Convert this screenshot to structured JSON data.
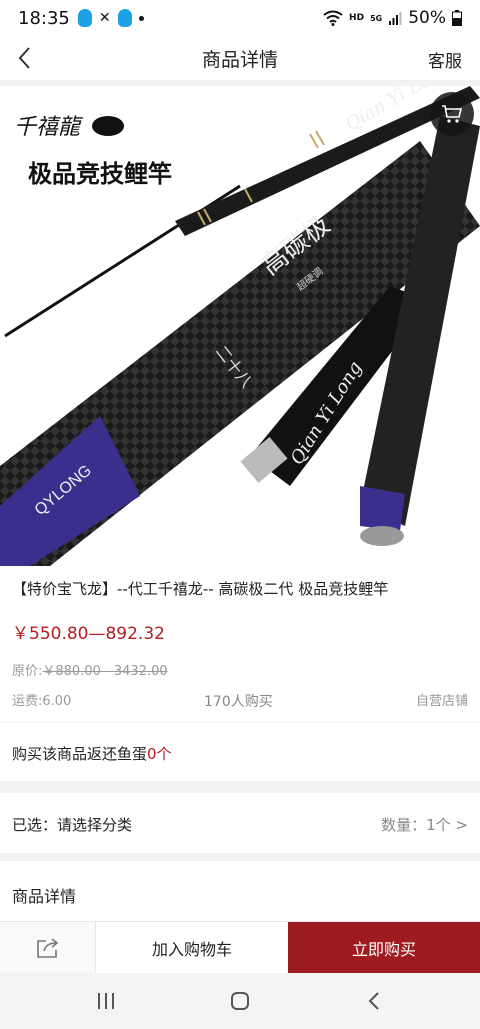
{
  "status_bar": {
    "time": "18:35",
    "network": "HD",
    "network_sub": "5G",
    "battery": "50%"
  },
  "nav": {
    "title": "商品详情",
    "service_label": "客服"
  },
  "product_image": {
    "logo_text": "千禧龍",
    "headline": "极品竞技鲤竿",
    "rod_text_1": "Qian Yi Long",
    "rod_text_2": "Qian Yi Long",
    "rod_text_3": "Qian Yi Long",
    "chinese_text": "高碳极",
    "chinese_small": "超硬调",
    "number_text": "二十八",
    "band_text": "QYLONG"
  },
  "product": {
    "name": "【特价宝飞龙】--代工千禧龙--  高碳极二代  极品竞技鲤竿",
    "price": "￥550.80—892.32",
    "original_price_label": "原价:",
    "original_price": "￥880.00—3432.00",
    "shipping": "运费:6.00",
    "buyers": "170人购买",
    "store_type": "自营店铺"
  },
  "reward": {
    "text": "购买该商品返还鱼蛋",
    "count": "0个"
  },
  "spec": {
    "label": "已选：请选择分类",
    "quantity": "数量：1个 >"
  },
  "details": {
    "label": "商品详情"
  },
  "actions": {
    "add_to_cart": "加入购物车",
    "buy_now": "立即购买"
  },
  "colors": {
    "price_red": "#b81c22",
    "buy_button": "#9e1b20",
    "rod_purple": "#3b2f8e"
  }
}
